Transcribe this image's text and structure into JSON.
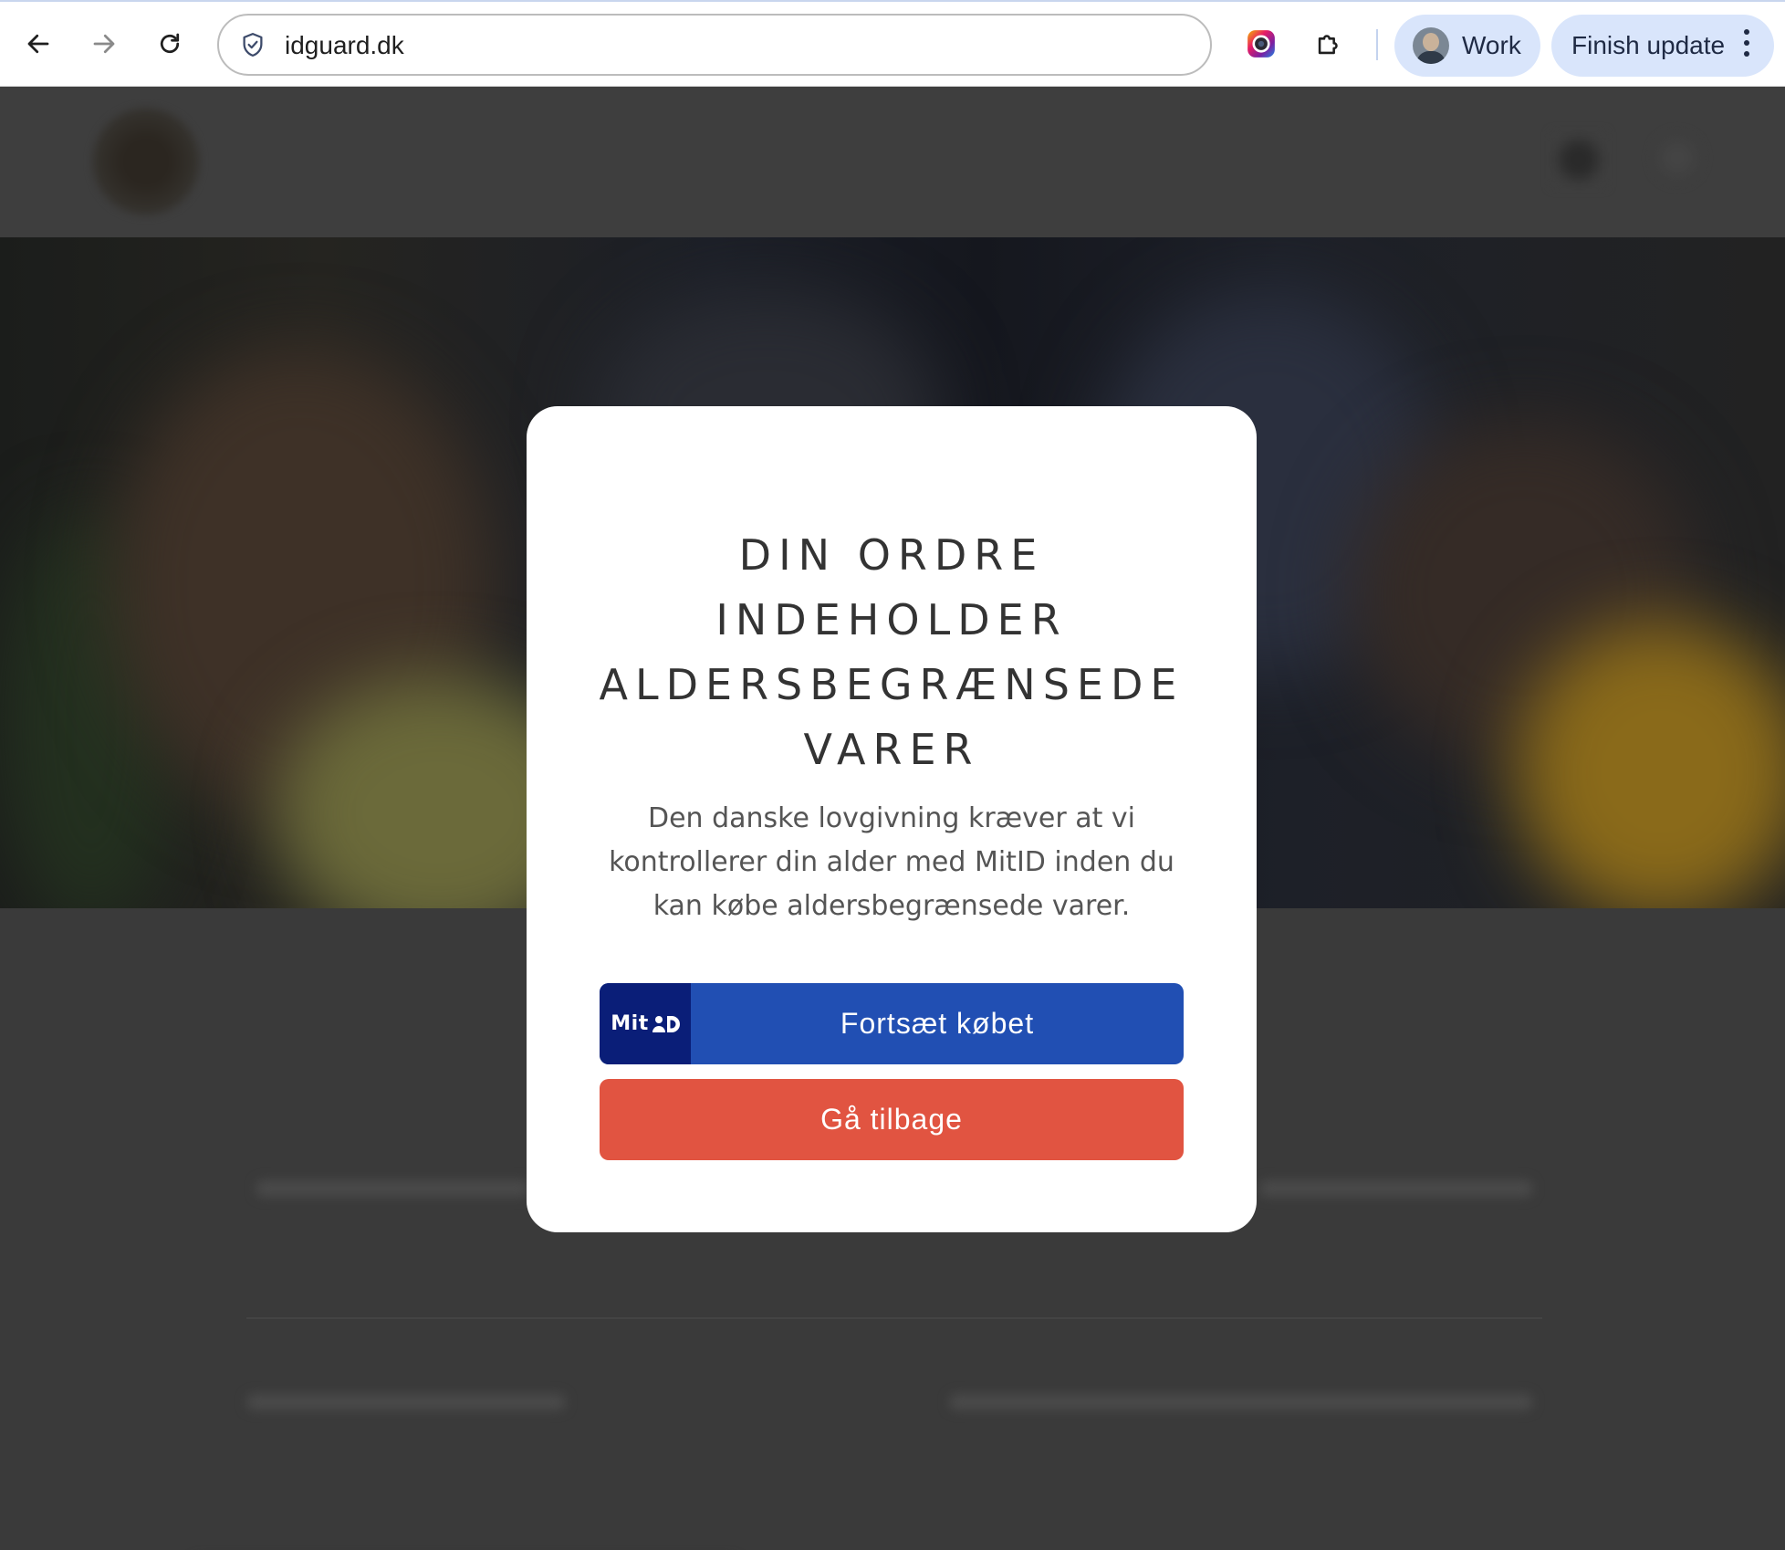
{
  "browser": {
    "url": "idguard.dk",
    "profile_label": "Work",
    "update_label": "Finish update"
  },
  "modal": {
    "title": "DIN ORDRE INDEHOLDER ALDERSBEGRÆNSEDE VARER",
    "body": "Den danske lovgivning kræver at vi kontrollerer din alder med MitID inden du kan købe aldersbegrænsede varer.",
    "mitid_badge_text": "Mit",
    "primary_button_label": "Fortsæt købet",
    "secondary_button_label": "Gå tilbage"
  },
  "colors": {
    "overlay": "#3a3a3a",
    "mitid_blue": "#214fb3",
    "mitid_dark": "#0a1e78",
    "back_red": "#e15441"
  }
}
